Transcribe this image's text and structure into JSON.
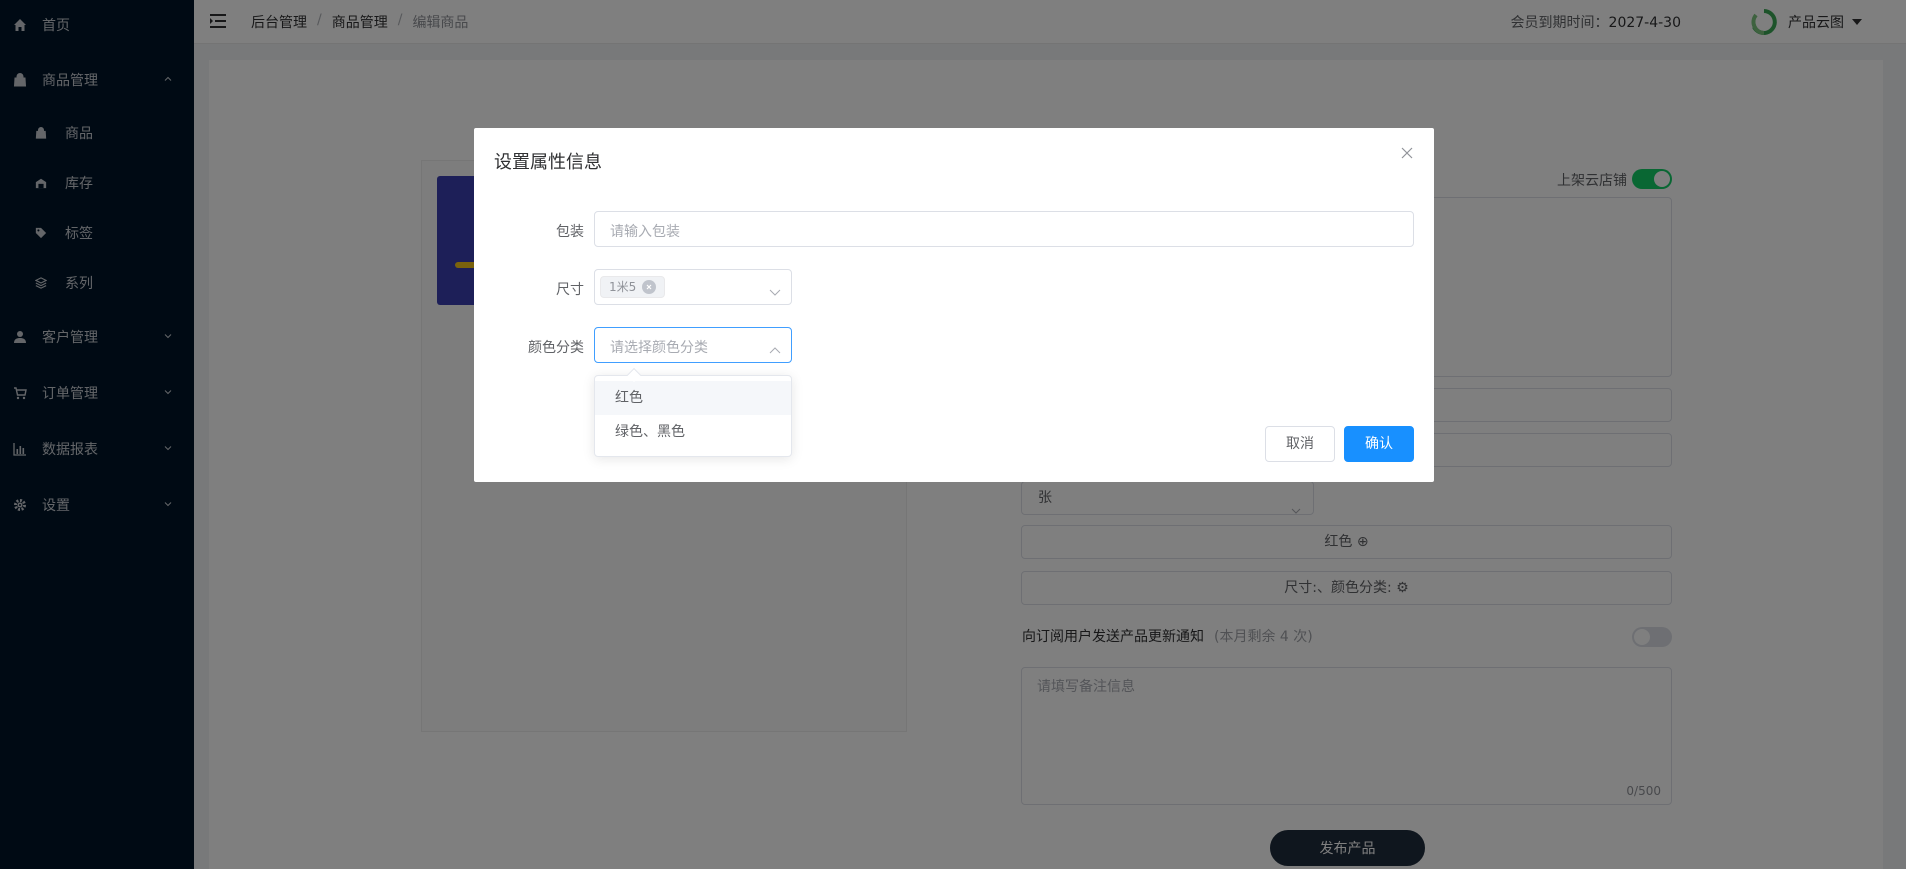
{
  "sidebar": {
    "items": [
      {
        "label": "首页",
        "icon": "home-icon"
      },
      {
        "label": "商品管理",
        "icon": "bag-icon",
        "expanded": true
      },
      {
        "label": "商品",
        "icon": "bag-icon"
      },
      {
        "label": "库存",
        "icon": "warehouse-icon"
      },
      {
        "label": "标签",
        "icon": "tag-icon"
      },
      {
        "label": "系列",
        "icon": "layers-icon"
      },
      {
        "label": "客户管理",
        "icon": "user-icon"
      },
      {
        "label": "订单管理",
        "icon": "cart-icon"
      },
      {
        "label": "数据报表",
        "icon": "chart-icon"
      },
      {
        "label": "设置",
        "icon": "gear-icon"
      }
    ]
  },
  "header": {
    "breadcrumb": [
      "后台管理",
      "商品管理",
      "编辑商品"
    ],
    "member_label": "会员到期时间：",
    "member_date": "2027-4-30",
    "brand": "产品云图"
  },
  "page": {
    "toggle_label": "上架云店铺",
    "unit_value": "张",
    "attr_color": "红色",
    "attr_summary": "尺寸:、颜色分类:",
    "notify_label": "向订阅用户发送产品更新通知",
    "notify_hint": "(本月剩余 4 次)",
    "remark_placeholder": "请填写备注信息",
    "remark_count": "0/500",
    "publish_label": "发布产品"
  },
  "dialog": {
    "title": "设置属性信息",
    "fields": {
      "package_label": "包装",
      "package_placeholder": "请输入包装",
      "size_label": "尺寸",
      "size_tag": "1米5",
      "color_label": "颜色分类",
      "color_placeholder": "请选择颜色分类"
    },
    "cancel_label": "取消",
    "confirm_label": "确认"
  },
  "dropdown": {
    "options": [
      "红色",
      "绿色、黑色"
    ]
  },
  "colors": {
    "sidebar_bg": "#001529",
    "primary": "#1890ff",
    "switch_on": "#13ce66",
    "publish_bg": "#1f2d3d"
  }
}
